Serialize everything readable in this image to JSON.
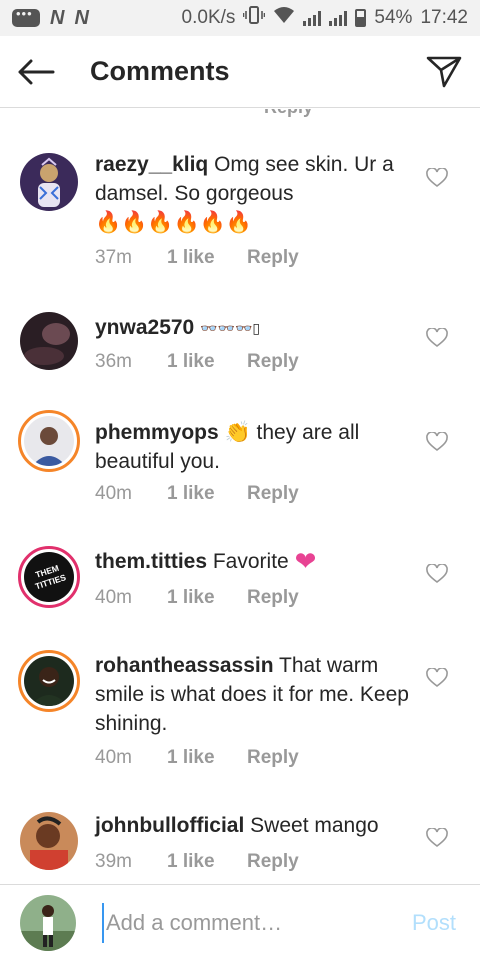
{
  "status_bar": {
    "carrier_1": "N",
    "carrier_2": "N",
    "speed": "0.0K/s",
    "battery": "54%",
    "time": "17:42"
  },
  "header": {
    "title": "Comments"
  },
  "comments": [
    {
      "username": "raezy__kliq",
      "text": "Omg see skin. Ur a damsel. So gorgeous",
      "emoji": "🔥🔥🔥🔥🔥🔥",
      "time": "37m",
      "likes": "1 like",
      "reply": "Reply"
    },
    {
      "username": "ynwa2570",
      "text": "",
      "emoji": "👓👓👓▯",
      "time": "36m",
      "likes": "1 like",
      "reply": "Reply"
    },
    {
      "username": "phemmyops",
      "text": "they are all beautiful you.",
      "emoji": "👏",
      "time": "40m",
      "likes": "1 like",
      "reply": "Reply"
    },
    {
      "username": "them.titties",
      "text": "Favorite",
      "emoji": "❤",
      "avatar_text": "THEM TITTIES",
      "time": "40m",
      "likes": "1 like",
      "reply": "Reply"
    },
    {
      "username": "rohantheassassin",
      "text": "That warm smile is what does it for me. Keep shining.",
      "emoji": "",
      "time": "40m",
      "likes": "1 like",
      "reply": "Reply"
    },
    {
      "username": "johnbullofficial",
      "text": "Sweet mango",
      "emoji": "",
      "time": "39m",
      "likes": "1 like",
      "reply": "Reply"
    }
  ],
  "composer": {
    "placeholder": "Add a comment…",
    "post_label": "Post"
  },
  "colors": {
    "accent": "#3897f0",
    "post_disabled": "#b2dffc",
    "ring": "#e1306c",
    "fire": "#f0521c",
    "heart_pink": "#e84393"
  }
}
